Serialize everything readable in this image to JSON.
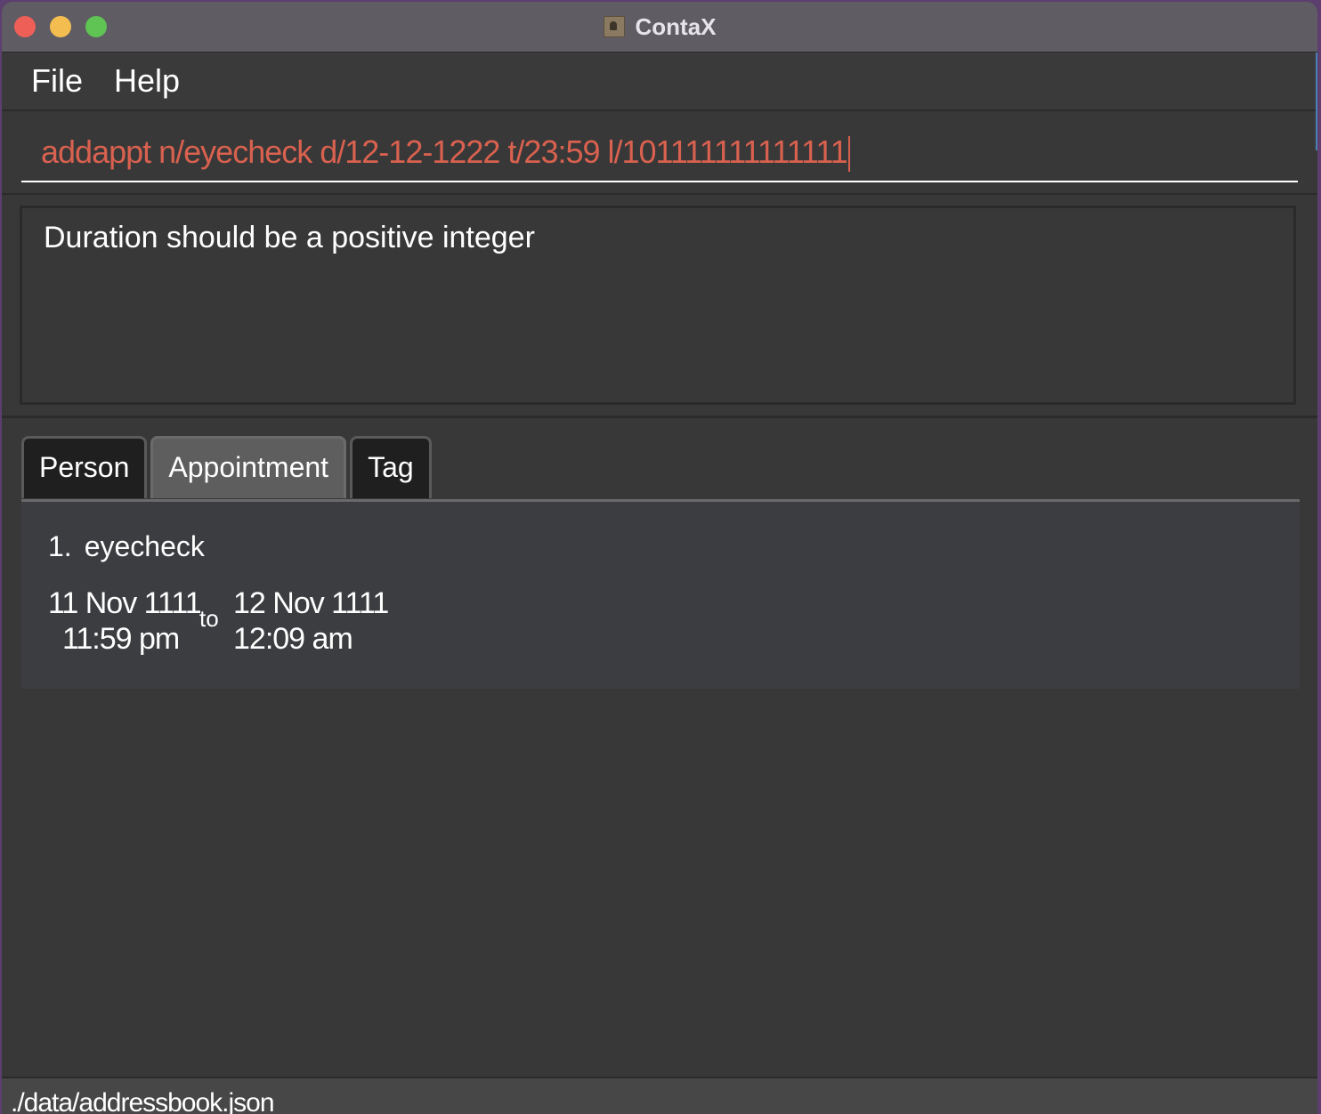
{
  "window": {
    "title": "ContaX"
  },
  "menu": {
    "file_label": "File",
    "help_label": "Help"
  },
  "command": {
    "value": "addappt n/eyecheck d/12-12-1222 t/23:59 l/101111111111111",
    "text_color": "#d9614f"
  },
  "result": {
    "message": "Duration should be a positive integer"
  },
  "tabs": [
    {
      "label": "Person",
      "active": false
    },
    {
      "label": "Appointment",
      "active": true
    },
    {
      "label": "Tag",
      "active": false
    }
  ],
  "appointments": [
    {
      "index": "1.",
      "name": "eyecheck",
      "start_date": "11 Nov 1111",
      "start_time": "11:59 pm",
      "to_label": "to",
      "end_date": "12 Nov 1111",
      "end_time": "12:09 am"
    }
  ],
  "status": {
    "path": "./data/addressbook.json"
  }
}
